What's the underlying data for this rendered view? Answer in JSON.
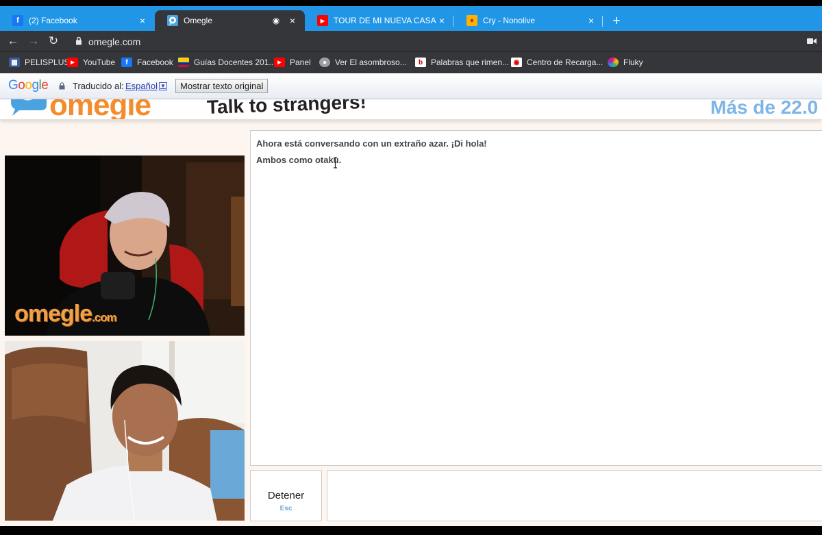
{
  "browser": {
    "tabs": [
      {
        "title": "(2) Facebook",
        "icon": "facebook-icon",
        "active": false
      },
      {
        "title": "Omegle",
        "icon": "omegle-icon",
        "active": true
      },
      {
        "title": "TOUR DE MI NUEVA CASA (de no",
        "icon": "youtube-icon",
        "active": false
      },
      {
        "title": "Cry - Nonolive",
        "icon": "nonolive-icon",
        "active": false
      }
    ],
    "new_tab_label": "+",
    "url": "omegle.com",
    "bookmarks": [
      {
        "label": "PELISPLUS",
        "icon": "pelisplus-icon"
      },
      {
        "label": "YouTube",
        "icon": "youtube-icon"
      },
      {
        "label": "Facebook",
        "icon": "facebook-icon"
      },
      {
        "label": "Guías Docentes 201...",
        "icon": "flag-icon"
      },
      {
        "label": "Panel",
        "icon": "youtube-icon"
      },
      {
        "label": "Ver El asombroso...",
        "icon": "penguin-icon"
      },
      {
        "label": "Palabras que rimen...",
        "icon": "document-icon"
      },
      {
        "label": "Centro de Recarga...",
        "icon": "recarga-icon"
      },
      {
        "label": "Fluky",
        "icon": "fluky-icon"
      }
    ],
    "colors": {
      "tabstrip": "#2196e6",
      "toolbar": "#35363a"
    }
  },
  "translate_bar": {
    "google_logo": "Google",
    "translated_to_label": "Traducido al:",
    "language": "Español",
    "show_original_button": "Mostrar texto original"
  },
  "omegle": {
    "logo": "omegle",
    "tagline": "Talk to strangers!",
    "online_count": "Más de 22.0",
    "watermark": {
      "main": "omegle",
      "suffix": ".com"
    },
    "chat_messages": [
      "Ahora está conversando con un extraño azar. ¡Di hola!",
      "Ambos como otaku."
    ],
    "stop_button": {
      "label": "Detener",
      "key": "Esc"
    },
    "colors": {
      "logo_orange": "#f48b2c",
      "count_blue": "#7eb5e6",
      "page_bg": "#fdf6f0"
    }
  }
}
